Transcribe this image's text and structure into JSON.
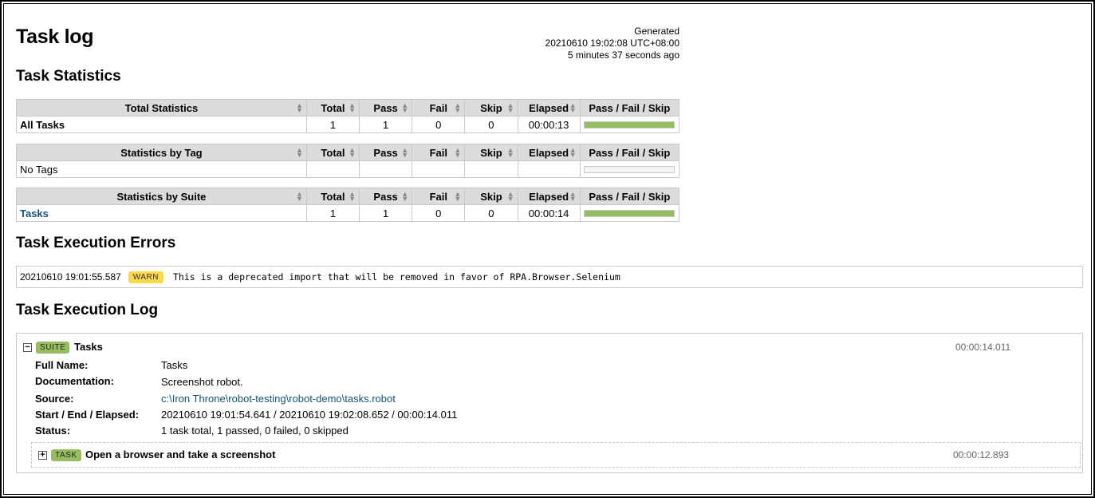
{
  "title": "Task log",
  "generated": {
    "label": "Generated",
    "timestamp": "20210610 19:02:08 UTC+08:00",
    "ago": "5 minutes 37 seconds ago"
  },
  "statistics": {
    "heading": "Task Statistics",
    "columns": [
      "Total",
      "Pass",
      "Fail",
      "Skip",
      "Elapsed",
      "Pass / Fail / Skip"
    ],
    "total": {
      "header": "Total Statistics",
      "row": {
        "name": "All Tasks",
        "total": "1",
        "pass": "1",
        "fail": "0",
        "skip": "0",
        "elapsed": "00:00:13",
        "pass_pct": 100
      }
    },
    "tag": {
      "header": "Statistics by Tag",
      "row": {
        "name": "No Tags",
        "total": "",
        "pass": "",
        "fail": "",
        "skip": "",
        "elapsed": "",
        "pass_pct": 0
      }
    },
    "suite": {
      "header": "Statistics by Suite",
      "row": {
        "name": "Tasks",
        "total": "1",
        "pass": "1",
        "fail": "0",
        "skip": "0",
        "elapsed": "00:00:14",
        "pass_pct": 100
      }
    }
  },
  "errors": {
    "heading": "Task Execution Errors",
    "items": [
      {
        "timestamp": "20210610 19:01:55.587",
        "level": "WARN",
        "message": "This is a deprecated import that will be removed in favor of RPA.Browser.Selenium"
      }
    ]
  },
  "log": {
    "heading": "Task Execution Log",
    "suite": {
      "toggle": "−",
      "badge": "SUITE",
      "name": "Tasks",
      "elapsed": "00:00:14.011",
      "meta": {
        "full_name_label": "Full Name:",
        "full_name": "Tasks",
        "documentation_label": "Documentation:",
        "documentation": "Screenshot robot.",
        "source_label": "Source:",
        "source": "c:\\Iron Throne\\robot-testing\\robot-demo\\tasks.robot",
        "times_label": "Start / End / Elapsed:",
        "times": "20210610 19:01:54.641 / 20210610 19:02:08.652 / 00:00:14.011",
        "status_label": "Status:",
        "status": "1 task total, 1 passed, 0 failed, 0 skipped"
      }
    },
    "task": {
      "toggle": "+",
      "badge": "TASK",
      "name": "Open a browser and take a screenshot",
      "elapsed": "00:00:12.893"
    }
  },
  "colors": {
    "pass": "#97bd61",
    "fail": "#ce3e01",
    "skip": "#fed84f",
    "header_bg": "#dcdcdc",
    "link": "#15527a"
  },
  "icons": {
    "sort": "sort-arrows-icon",
    "collapse": "minus-icon",
    "expand": "plus-icon"
  }
}
